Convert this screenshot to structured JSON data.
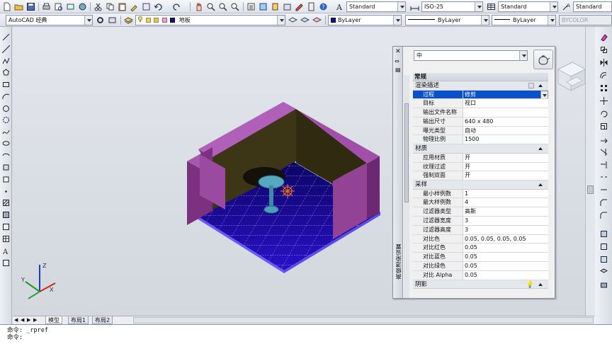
{
  "app": {
    "title": "AutoCAD"
  },
  "toolbar_top": {
    "text_style": "Standard",
    "dim_style": "ISO-25",
    "table_style": "Standard",
    "multileader_style": "Standard"
  },
  "toolbar_second": {
    "workspace": "AutoCAD 经典",
    "layer": "地板",
    "color": "ByLayer",
    "linetype": "ByLayer",
    "lineweight": "ByLayer",
    "plot_style": "BYCOLOR"
  },
  "layout_tabs": [
    "模型",
    "布局1",
    "布局2"
  ],
  "command_line": {
    "history": "命令: _rpref",
    "prompt": "命令:"
  },
  "render_palette": {
    "title": "高级渲染设置",
    "preset": "中",
    "sections": [
      {
        "name": "常规",
        "subsections": [
          {
            "name": "渲染描述",
            "rows": [
              {
                "key": "过程",
                "value": "修剪",
                "selected": true
              },
              {
                "key": "目标",
                "value": "视口"
              },
              {
                "key": "输出文件名称",
                "value": ""
              },
              {
                "key": "输出尺寸",
                "value": "640 x 480"
              },
              {
                "key": "曝光类型",
                "value": "自动"
              },
              {
                "key": "物理比例",
                "value": "1500"
              }
            ]
          },
          {
            "name": "材质",
            "rows": [
              {
                "key": "应用材质",
                "value": "开"
              },
              {
                "key": "纹理过滤",
                "value": "开"
              },
              {
                "key": "强制双面",
                "value": "开"
              }
            ]
          },
          {
            "name": "采样",
            "rows": [
              {
                "key": "最小样例数",
                "value": "1"
              },
              {
                "key": "最大样例数",
                "value": "4"
              },
              {
                "key": "过滤器类型",
                "value": "高斯"
              },
              {
                "key": "过滤器宽度",
                "value": "3"
              },
              {
                "key": "过滤器高度",
                "value": "3"
              },
              {
                "key": "对比色",
                "value": "0.05, 0.05, 0.05, 0.05"
              },
              {
                "key": "对比红色",
                "value": "0.05"
              },
              {
                "key": "对比蓝色",
                "value": "0.05"
              },
              {
                "key": "对比绿色",
                "value": "0.05"
              },
              {
                "key": "对比 Alpha",
                "value": "0.05"
              }
            ]
          },
          {
            "name": "阴影",
            "rows": []
          }
        ]
      }
    ]
  },
  "ucs_icon": {
    "labels": [
      "X",
      "Y",
      "Z"
    ]
  },
  "colors": {
    "wall": "#8a3a8c",
    "floor": "#1a0a9c",
    "selection": "#0a50c8"
  }
}
